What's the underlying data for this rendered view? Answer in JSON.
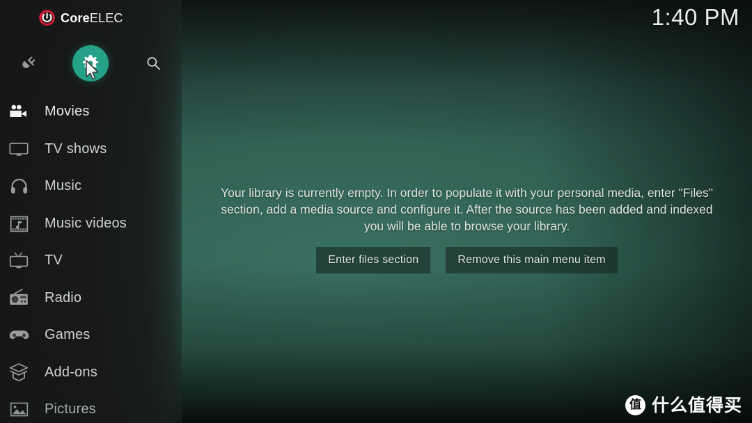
{
  "brand": {
    "name_bold": "Core",
    "name_light": "ELEC",
    "logo_icon": "power-logo-icon",
    "logo_ring_color": "#d71b35"
  },
  "header": {
    "clock": "1:40 PM"
  },
  "top_icons": [
    {
      "name": "power-icon",
      "label": "Power",
      "selected": false
    },
    {
      "name": "settings-gear-icon",
      "label": "Settings",
      "selected": true,
      "highlight_color": "#25a188"
    },
    {
      "name": "search-icon",
      "label": "Search",
      "selected": false
    }
  ],
  "sidebar": {
    "items": [
      {
        "label": "Movies",
        "icon": "movie-camera-icon",
        "state": "bright"
      },
      {
        "label": "TV shows",
        "icon": "television-icon",
        "state": "normal"
      },
      {
        "label": "Music",
        "icon": "headphones-icon",
        "state": "normal"
      },
      {
        "label": "Music videos",
        "icon": "music-video-icon",
        "state": "normal"
      },
      {
        "label": "TV",
        "icon": "retro-tv-icon",
        "state": "normal"
      },
      {
        "label": "Radio",
        "icon": "radio-icon",
        "state": "normal"
      },
      {
        "label": "Games",
        "icon": "gamepad-icon",
        "state": "normal"
      },
      {
        "label": "Add-ons",
        "icon": "addon-box-icon",
        "state": "normal"
      },
      {
        "label": "Pictures",
        "icon": "pictures-icon",
        "state": "dim"
      }
    ]
  },
  "main": {
    "empty_message": "Your library is currently empty. In order to populate it with your personal media, enter \"Files\" section, add a media source and configure it. After the source has been added and indexed you will be able to browse your library.",
    "buttons": [
      {
        "label": "Enter files section",
        "name": "enter-files-section-button"
      },
      {
        "label": "Remove this main menu item",
        "name": "remove-main-menu-item-button"
      }
    ]
  },
  "watermark": {
    "badge": "值",
    "text": "什么值得买"
  },
  "theme": {
    "background_green": "#316254",
    "background_dark": "#15211f",
    "sidebar_dark": "#171918",
    "accent_teal": "#25a188",
    "text_light": "#cfd2d1"
  }
}
